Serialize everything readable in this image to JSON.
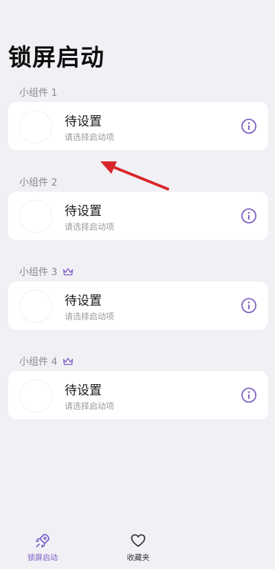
{
  "header": {
    "title": "锁屏启动"
  },
  "widgets": [
    {
      "section": "小组件 1",
      "premium": false,
      "title": "待设置",
      "subtitle": "请选择启动项"
    },
    {
      "section": "小组件 2",
      "premium": false,
      "title": "待设置",
      "subtitle": "请选择启动项"
    },
    {
      "section": "小组件 3",
      "premium": true,
      "title": "待设置",
      "subtitle": "请选择启动项"
    },
    {
      "section": "小组件 4",
      "premium": true,
      "title": "待设置",
      "subtitle": "请选择启动项"
    }
  ],
  "tabbar": {
    "items": [
      {
        "label": "锁屏启动",
        "icon": "rocket-icon",
        "active": true
      },
      {
        "label": "收藏夹",
        "icon": "heart-icon",
        "active": false
      }
    ]
  },
  "colors": {
    "accent": "#7b5cc4",
    "background": "#f1f0f5",
    "card": "#ffffff",
    "annotation_arrow": "#d9262a"
  }
}
